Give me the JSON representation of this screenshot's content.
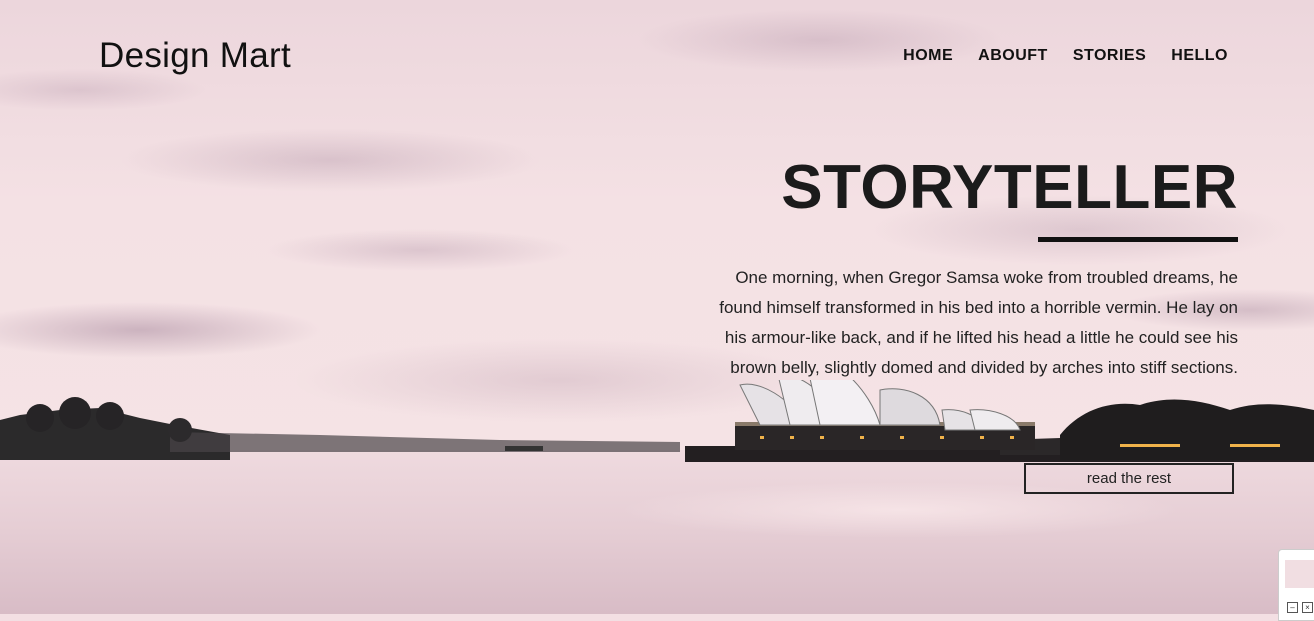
{
  "brand": "Design Mart",
  "nav": [
    "HOME",
    "ABOUFT",
    "STORIES",
    "HELLO"
  ],
  "hero": {
    "title": "STORYTELLER",
    "paragraph": "One morning, when Gregor Samsa woke from troubled dreams, he found himself transformed in his bed into a horrible vermin. He lay on his armour-like back, and if he lifted his head a little he could see his brown belly, slightly domed and divided by arches into stiff sections.",
    "cta": "read the rest"
  },
  "widget": {
    "minimize": "–",
    "close": "×"
  },
  "colors": {
    "text": "#111111",
    "sky": "#f3dfe3",
    "water": "#e5cdd4"
  },
  "icons": [
    "minimize-icon",
    "close-icon"
  ]
}
